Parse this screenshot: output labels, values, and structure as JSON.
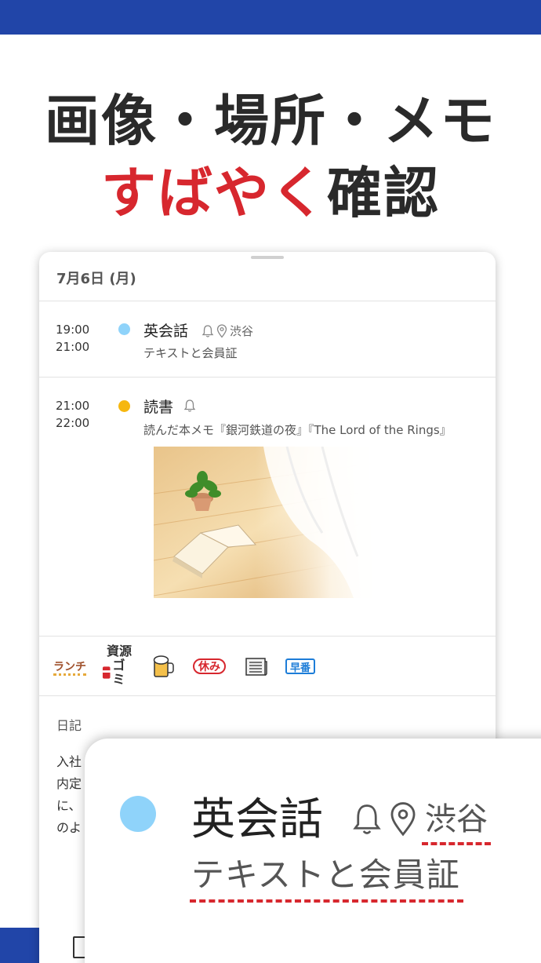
{
  "headline": {
    "line1": "画像・場所・メモ",
    "line2_red": "すばやく",
    "line2_dark": "確認"
  },
  "colors": {
    "brand_blue": "#2145a8",
    "accent_red": "#d7272e",
    "event1_dot": "#8fd3fa",
    "event2_dot": "#f6b70f"
  },
  "day_card": {
    "date": "7月6日 (月)",
    "events": [
      {
        "start": "19:00",
        "end": "21:00",
        "title": "英会話",
        "icons": [
          "bell-icon",
          "location-pin-icon"
        ],
        "location": "渋谷",
        "note": "テキストと会員証"
      },
      {
        "start": "21:00",
        "end": "22:00",
        "title": "読書",
        "icons": [
          "bell-icon"
        ],
        "note": "読んだ本メモ『銀河鉄道の夜』『The Lord of the Rings』"
      }
    ],
    "stamps": {
      "lunch": "ランチ",
      "gomi_top": "資源",
      "gomi_bottom": "ゴミ",
      "off": "休み",
      "early": "早番"
    },
    "diary": {
      "label": "日記",
      "lines": [
        "入社",
        "内定",
        "に、",
        "のよ"
      ]
    }
  },
  "zoom_panel": {
    "title": "英会話",
    "location": "渋谷",
    "note": "テキストと会員証"
  }
}
